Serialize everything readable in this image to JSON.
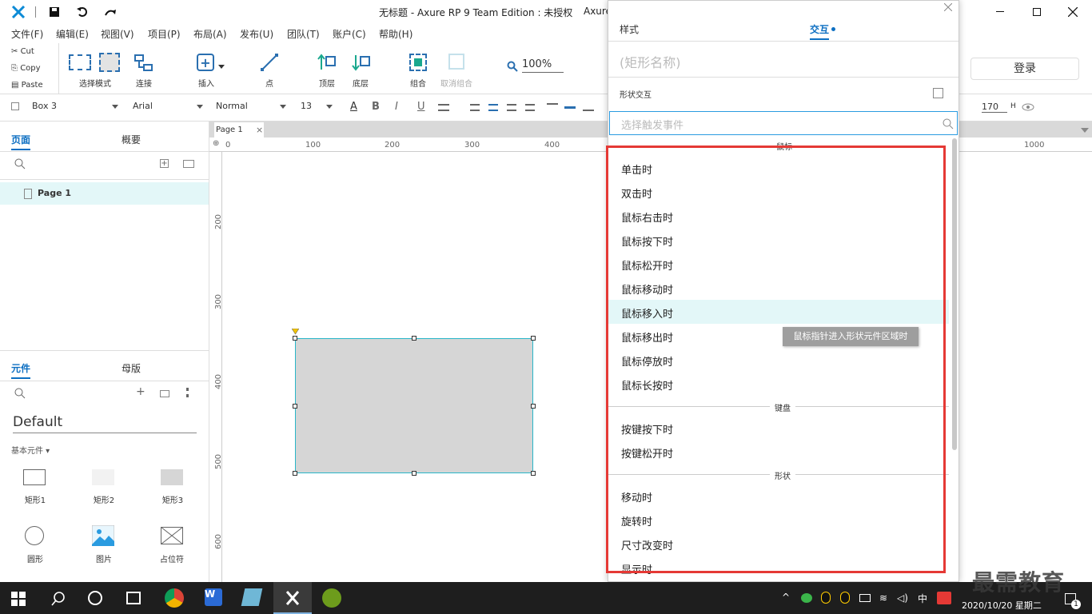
{
  "titlebar": {
    "title": "无标题 - Axure RP 9 Team Edition : 未授权",
    "title_trunc": "Axure"
  },
  "menu": [
    "文件(F)",
    "编辑(E)",
    "视图(V)",
    "项目(P)",
    "布局(A)",
    "发布(U)",
    "团队(T)",
    "账户(C)",
    "帮助(H)"
  ],
  "clipboard": {
    "cut": "Cut",
    "copy": "Copy",
    "paste": "Paste"
  },
  "toolbar": {
    "select_mode": "选择模式",
    "connect": "连接",
    "insert": "插入",
    "point": "点",
    "top": "顶层",
    "bottom": "底层",
    "group": "组合",
    "ungroup": "取消组合",
    "zoom": "100%",
    "align_left": "左",
    "login": "登录"
  },
  "format": {
    "widget": "Box 3",
    "font": "Arial",
    "style": "Normal",
    "size": "13",
    "height": "170",
    "h": "H"
  },
  "left": {
    "tabs": [
      "页面",
      "概要"
    ],
    "page_item": "Page 1",
    "widget_tabs": [
      "元件",
      "母版"
    ],
    "library": "Default",
    "category": "基本元件 ▾",
    "widgets": [
      "矩形1",
      "矩形2",
      "矩形3",
      "圆形",
      "图片",
      "占位符"
    ]
  },
  "canvas": {
    "tab": "Page 1",
    "ruler_h": [
      "0",
      "100",
      "200",
      "300",
      "400",
      "1000"
    ],
    "ruler_v": [
      "200",
      "300",
      "400",
      "500",
      "600"
    ]
  },
  "panel": {
    "tabs": [
      "样式",
      "交互"
    ],
    "shape_name_placeholder": "(矩形名称)",
    "shape_interaction": "形状交互",
    "search_placeholder": "选择触发事件",
    "sections": {
      "mouse": "鼠标",
      "keyboard": "键盘",
      "shape": "形状"
    },
    "mouse_events": [
      "单击时",
      "双击时",
      "鼠标右击时",
      "鼠标按下时",
      "鼠标松开时",
      "鼠标移动时",
      "鼠标移入时",
      "鼠标移出时",
      "鼠标停放时",
      "鼠标长按时"
    ],
    "keyboard_events": [
      "按键按下时",
      "按键松开时"
    ],
    "shape_events": [
      "移动时",
      "旋转时",
      "尺寸改变时",
      "显示时"
    ],
    "tooltip": "鼠标指针进入形状元件区域时"
  },
  "taskbar": {
    "ime": "中",
    "datetime": "2020/10/20 星期二",
    "watermark": "最需教育",
    "notif": "1"
  },
  "colors": {
    "accent": "#0d6fc2",
    "highlight": "#e3f7f8",
    "red_box": "#e53935",
    "shape_fill": "#d6d6d6",
    "shape_border": "#29b6c8"
  }
}
